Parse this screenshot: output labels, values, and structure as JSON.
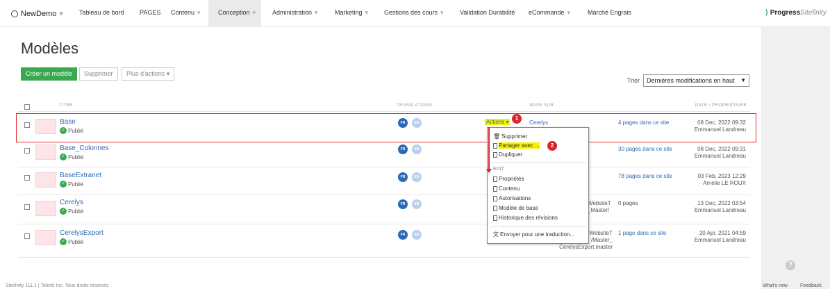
{
  "nav": {
    "brand": "NewDemo",
    "items": [
      {
        "label": "Tableau de bord",
        "caret": false
      },
      {
        "label": "PAGES",
        "caret": false
      },
      {
        "label": "Contenu",
        "caret": true
      },
      {
        "label": "Conception",
        "caret": true
      },
      {
        "label": "Administration",
        "caret": true
      },
      {
        "label": "Marketing",
        "caret": true
      },
      {
        "label": "Gestions des cours",
        "caret": true
      },
      {
        "label": "Validation Durabilité",
        "caret": false
      },
      {
        "label": "eCommande",
        "caret": true
      },
      {
        "label": "Marché Engrais",
        "caret": false
      }
    ],
    "logo_main": "Progress",
    "logo_sub": "Sitefinity"
  },
  "page": {
    "title": "Modèles",
    "create_button": "Créer un modèle",
    "delete_button": "Supprimer",
    "more_actions_button": "Plus d'actions",
    "sort_label": "Trier",
    "sort_value": "Dernières modifications en haut"
  },
  "table": {
    "headers": {
      "title": "TITRE",
      "translations": "TRANSLATIONS",
      "based_on": "BASE SUR",
      "date": "DATE / PROPRIÉTAIRE"
    },
    "rows": [
      {
        "title": "Base",
        "status": "Publié",
        "lang1": "FR",
        "lang2": "EN",
        "based_on": "Cerelys",
        "pages": "4 pages dans ce site",
        "date": "08 Dec, 2022 09:32",
        "owner": "Emmanuel Landreau"
      },
      {
        "title": "Base_Colonnes",
        "status": "Publié",
        "lang1": "FR",
        "lang2": "EN",
        "based_on": "",
        "pages": "30 pages dans ce site",
        "date": "08 Dec, 2022 09:31",
        "owner": "Emmanuel Landreau"
      },
      {
        "title": "BaseExtranet",
        "status": "Publié",
        "lang1": "FR",
        "lang2": "EN",
        "based_on": "",
        "pages": "78 pages dans ce site",
        "date": "03 Feb, 2023 12:29",
        "owner": "Amélie LE ROUX"
      },
      {
        "title": "Cerelys",
        "status": "Publié",
        "lang1": "FR",
        "lang2": "EN",
        "based_on": "WebsiteT\n_Master/",
        "pages": "0 pages",
        "date": "13 Dec, 2022 03:54",
        "owner": "Emmanuel Landreau"
      },
      {
        "title": "CerelysExport",
        "status": "Publié",
        "lang1": "FR",
        "lang2": "EN",
        "based_on": "WebsiteT\n_Master/\nCerelysExport.master",
        "pages": "1 page dans ce site",
        "date": "20 Apr, 2021 04:59",
        "owner": "Emmanuel Landreau"
      }
    ]
  },
  "actions_menu": {
    "trigger": "Actions",
    "items": {
      "delete": "Supprimer",
      "share": "Partager avec ...",
      "duplicate": "Dupliquer",
      "section_edit": "EDIT",
      "properties": "Propriétés",
      "content": "Contenu",
      "permissions": "Autorisations",
      "base_template": "Modèle de base",
      "revision_history": "Historique des révisions",
      "send_translation": "Envoyer pour une traduction..."
    }
  },
  "annotations": {
    "badge1": "1",
    "badge2": "2"
  },
  "footer": {
    "copyright": "Sitefinity 111.1 | Telerik Inc. Tous droits réservés",
    "whats_new": "What's new",
    "feedback": "Feedback"
  }
}
